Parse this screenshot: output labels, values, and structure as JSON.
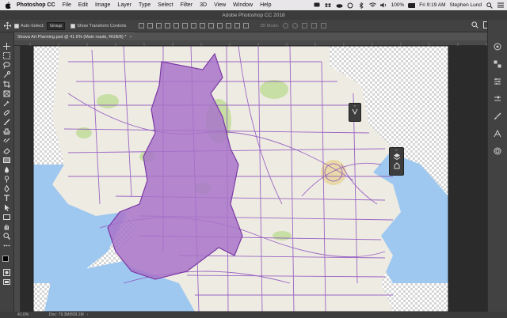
{
  "menubar": {
    "app_name": "Photoshop CC",
    "items": [
      "File",
      "Edit",
      "Image",
      "Layer",
      "Type",
      "Select",
      "Filter",
      "3D",
      "View",
      "Window",
      "Help"
    ],
    "battery": "100%",
    "clock": "Fri 9:19 AM",
    "user": "Stephen Lund"
  },
  "window": {
    "title": "Adobe Photoshop CC 2018"
  },
  "options": {
    "auto_select_label": "Auto-Select:",
    "auto_select_value": "Group",
    "show_transform_label": "Show Transform Controls",
    "three_d_label": "3D Mode:"
  },
  "document": {
    "tab_title": "Strava Art Planning.psd @ 41.6% (Main roads, RGB/8) *"
  },
  "status": {
    "zoom": "41.6%",
    "doc_size": "Doc: 79.3M/839.1M"
  },
  "colors": {
    "route": "#7b3aa6",
    "route_fill": "#a874c9",
    "water": "#9ec8f0",
    "land": "#eeebe2",
    "park": "#c7dfa5"
  }
}
